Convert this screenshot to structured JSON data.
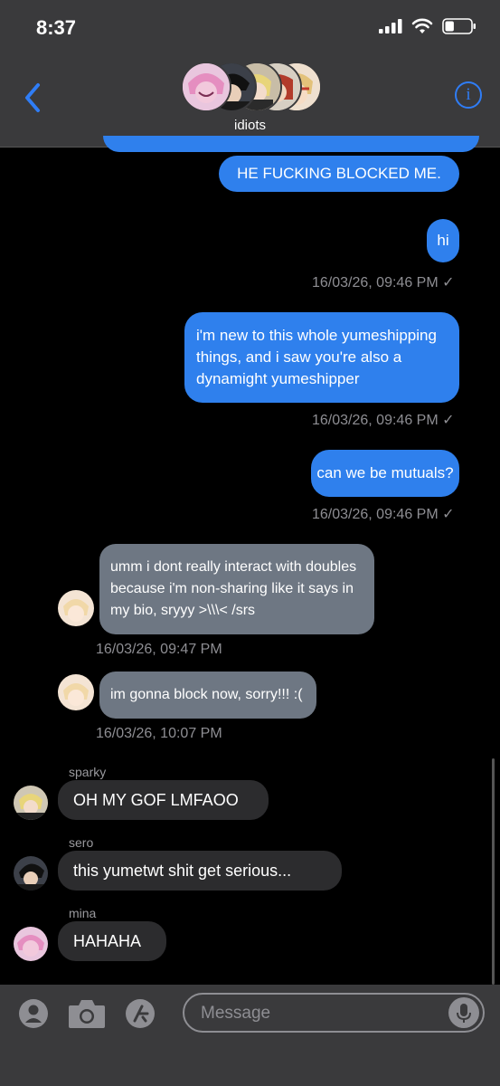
{
  "status_bar": {
    "time": "8:37",
    "battery_level": 0.35
  },
  "header": {
    "group_name": "idiots",
    "info_label": "i"
  },
  "messages": {
    "m0": {
      "text": "HE FUCKING BLOCKED ME."
    },
    "m1": {
      "text": "hi",
      "timestamp": "16/03/26, 09:46 PM ✓"
    },
    "m2": {
      "line1": "i'm new to this whole yumeshipping",
      "line2": "things, and i saw you're also a",
      "line3": "dynamight yumeshipper",
      "timestamp": "16/03/26, 09:46 PM ✓"
    },
    "m3": {
      "text": "can we be mutuals?",
      "timestamp": "16/03/26, 09:46 PM ✓"
    },
    "m4": {
      "line1": "umm i dont really interact with doubles",
      "line2": "because i'm non-sharing like it says in",
      "line3": "my bio, sryyy >\\\\\\< /srs",
      "timestamp": "16/03/26, 09:47 PM"
    },
    "m5": {
      "text": "im gonna block now, sorry!!! :(",
      "timestamp": "16/03/26, 10:07 PM"
    },
    "m6": {
      "sender": "sparky",
      "text": "OH MY GOF LMFAOO"
    },
    "m7": {
      "sender": "sero",
      "text": "this yumetwt shit get serious..."
    },
    "m8": {
      "sender": "mina",
      "text": "HAHAHA"
    }
  },
  "input": {
    "placeholder": "Message"
  },
  "colors": {
    "outgoing": "#2f80ed",
    "incoming_quoted": "#6e7783",
    "incoming": "#2c2c2e",
    "accent": "#2f7df6",
    "bar": "#3a3a3c"
  },
  "icons": [
    "back-chevron-icon",
    "info-icon",
    "signal-icon",
    "wifi-icon",
    "battery-icon",
    "memoji-icon",
    "camera-icon",
    "app-store-icon",
    "microphone-icon"
  ]
}
